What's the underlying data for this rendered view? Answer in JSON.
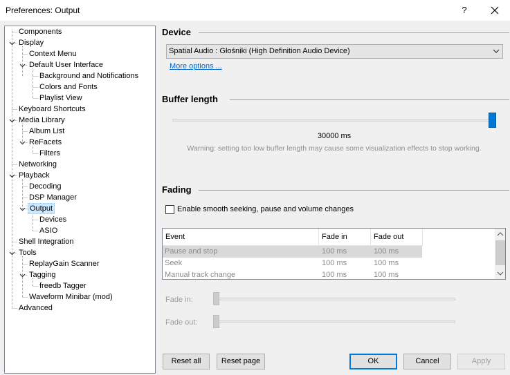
{
  "window": {
    "title": "Preferences: Output",
    "help_label": "?",
    "close_icon": "close-icon"
  },
  "tree": {
    "items": [
      {
        "label": "Components"
      },
      {
        "label": "Display"
      },
      {
        "label": "Context Menu"
      },
      {
        "label": "Default User Interface"
      },
      {
        "label": "Background and Notifications"
      },
      {
        "label": "Colors and Fonts"
      },
      {
        "label": "Playlist View"
      },
      {
        "label": "Keyboard Shortcuts"
      },
      {
        "label": "Media Library"
      },
      {
        "label": "Album List"
      },
      {
        "label": "ReFacets"
      },
      {
        "label": "Filters"
      },
      {
        "label": "Networking"
      },
      {
        "label": "Playback"
      },
      {
        "label": "Decoding"
      },
      {
        "label": "DSP Manager"
      },
      {
        "label": "Output"
      },
      {
        "label": "Devices"
      },
      {
        "label": "ASIO"
      },
      {
        "label": "Shell Integration"
      },
      {
        "label": "Tools"
      },
      {
        "label": "ReplayGain Scanner"
      },
      {
        "label": "Tagging"
      },
      {
        "label": "freedb Tagger"
      },
      {
        "label": "Waveform Minibar (mod)"
      },
      {
        "label": "Advanced"
      }
    ],
    "selected": "Output"
  },
  "device": {
    "section_title": "Device",
    "selected_device": "Spatial Audio : Głośniki (High Definition Audio Device)",
    "more_options_label": "More options ..."
  },
  "buffer": {
    "section_title": "Buffer length",
    "value_label": "30000 ms",
    "slider_position": 1.0,
    "warning": "Warning: setting too low buffer length may cause some visualization effects to stop working."
  },
  "fading": {
    "section_title": "Fading",
    "smooth_checkbox_label": "Enable smooth seeking, pause and volume changes",
    "smooth_checked": false,
    "columns": [
      "Event",
      "Fade in",
      "Fade out"
    ],
    "rows": [
      {
        "event": "Pause and stop",
        "fade_in": "100 ms",
        "fade_out": "100 ms"
      },
      {
        "event": "Seek",
        "fade_in": "100 ms",
        "fade_out": "100 ms"
      },
      {
        "event": "Manual track change",
        "fade_in": "100 ms",
        "fade_out": "100 ms"
      }
    ],
    "fade_in_label": "Fade in:",
    "fade_out_label": "Fade out:"
  },
  "buttons": {
    "reset_all": "Reset all",
    "reset_page": "Reset page",
    "ok": "OK",
    "cancel": "Cancel",
    "apply": "Apply"
  },
  "colors": {
    "accent": "#0078d7",
    "link": "#0066cc",
    "selection": "#cce8ff"
  }
}
